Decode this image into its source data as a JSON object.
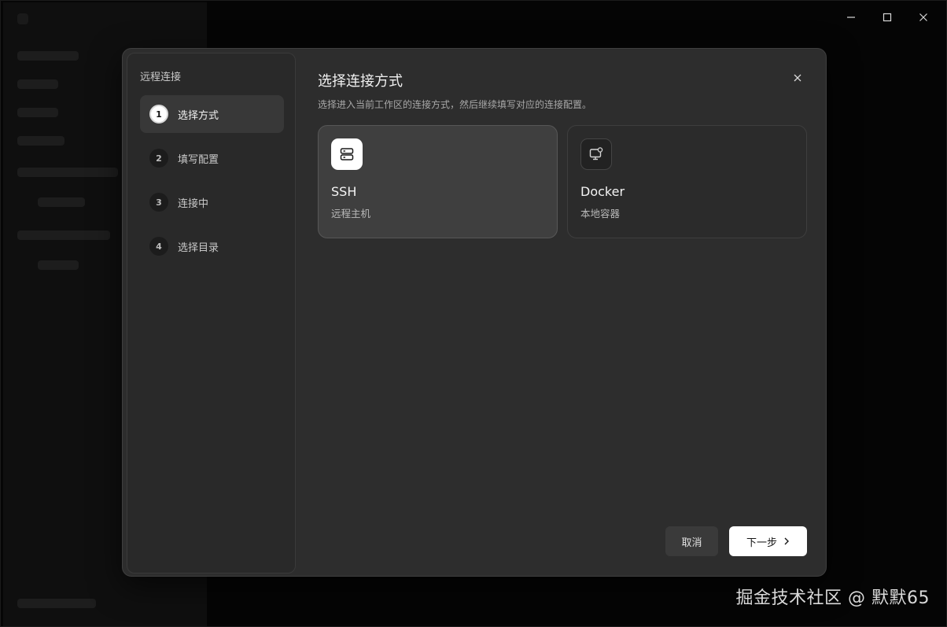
{
  "window": {
    "minimize_glyph": "—",
    "maximize_glyph": "☐",
    "close_glyph": "✕"
  },
  "dialog": {
    "sidebar_title": "远程连接",
    "steps": [
      {
        "num": "1",
        "label": "选择方式",
        "active": true
      },
      {
        "num": "2",
        "label": "填写配置",
        "active": false
      },
      {
        "num": "3",
        "label": "连接中",
        "active": false
      },
      {
        "num": "4",
        "label": "选择目录",
        "active": false
      }
    ],
    "title": "选择连接方式",
    "subtitle": "选择进入当前工作区的连接方式，然后继续填写对应的连接配置。",
    "options": [
      {
        "title": "SSH",
        "desc": "远程主机",
        "icon": "server-icon",
        "selected": true
      },
      {
        "title": "Docker",
        "desc": "本地容器",
        "icon": "monitor-gear-icon",
        "selected": false
      }
    ],
    "cancel_label": "取消",
    "next_label": "下一步"
  },
  "watermark": "掘金技术社区 @ 默默65",
  "colors": {
    "dialog_bg": "#2d2d2d",
    "selected_card_bg": "#3f3f3f",
    "primary_button_bg": "#ffffff"
  }
}
